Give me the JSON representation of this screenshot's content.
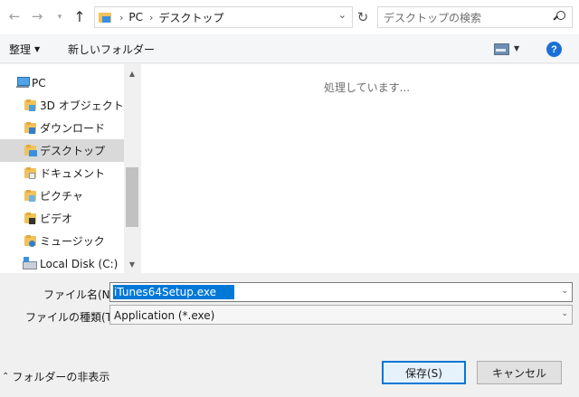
{
  "address": {
    "path": [
      "PC",
      "デスクトップ"
    ],
    "search_placeholder": "デスクトップの検索"
  },
  "toolbar": {
    "organize_label": "整理",
    "new_folder_label": "新しいフォルダー",
    "help_label": "?"
  },
  "nav": {
    "items": [
      {
        "label": "PC",
        "icon": "pc-icon"
      },
      {
        "label": "3D オブジェクト",
        "icon": "objects-3d-folder-icon"
      },
      {
        "label": "ダウンロード",
        "icon": "downloads-folder-icon"
      },
      {
        "label": "デスクトップ",
        "icon": "desktop-folder-icon",
        "selected": true
      },
      {
        "label": "ドキュメント",
        "icon": "documents-folder-icon"
      },
      {
        "label": "ピクチャ",
        "icon": "pictures-folder-icon"
      },
      {
        "label": "ビデオ",
        "icon": "videos-folder-icon"
      },
      {
        "label": "ミュージック",
        "icon": "music-folder-icon"
      },
      {
        "label": "Local Disk (C:)",
        "icon": "local-disk-icon"
      }
    ]
  },
  "content": {
    "status_text": "処理しています..."
  },
  "form": {
    "filename_label": "ファイル名(N):",
    "filename_value": "iTunes64Setup.exe",
    "filetype_label": "ファイルの種類(T):",
    "filetype_value": "Application (*.exe)"
  },
  "footer": {
    "hide_folders_label": "フォルダーの非表示",
    "save_label": "保存(S)",
    "cancel_label": "キャンセル"
  },
  "colors": {
    "accent": "#0078d7",
    "selected_nav_bg": "#d9d9d9",
    "help_blue": "#1c6fd6"
  }
}
